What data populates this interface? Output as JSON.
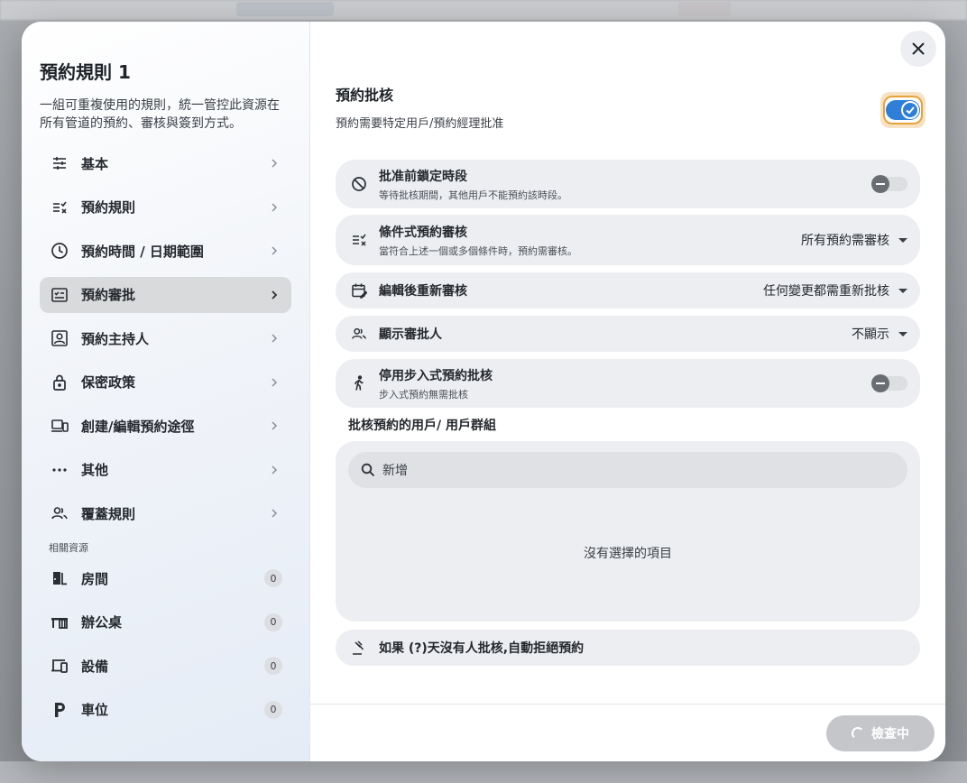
{
  "modal": {
    "title": "預約規則 1",
    "description": "一組可重複使用的規則，統一管控此資源在所有管道的預約、審核與簽到方式。"
  },
  "sidebar": {
    "items": [
      {
        "label": "基本",
        "icon": "sliders-icon"
      },
      {
        "label": "預約規則",
        "icon": "rules-list-icon"
      },
      {
        "label": "預約時間 / 日期範圍",
        "icon": "clock-icon"
      },
      {
        "label": "預約審批",
        "icon": "approval-checklist-icon",
        "active": true
      },
      {
        "label": "預約主持人",
        "icon": "host-badge-icon"
      },
      {
        "label": "保密政策",
        "icon": "lock-icon"
      },
      {
        "label": "創建/編輯預約途徑",
        "icon": "devices-icon"
      },
      {
        "label": "其他",
        "icon": "more-dots-icon"
      },
      {
        "label": "覆蓋規則",
        "icon": "people-icon"
      }
    ],
    "related_label": "相關資源",
    "resources": [
      {
        "label": "房間",
        "count": "0",
        "icon": "door-icon"
      },
      {
        "label": "辦公桌",
        "count": "0",
        "icon": "desk-icon"
      },
      {
        "label": "設備",
        "count": "0",
        "icon": "equipment-icon"
      },
      {
        "label": "車位",
        "count": "0",
        "icon": "parking-icon"
      }
    ]
  },
  "main": {
    "title": "預約批核",
    "subtitle": "預約需要特定用戶/預約經理批准",
    "approval_enabled": true,
    "rows": {
      "lock": {
        "title": "批准前鎖定時段",
        "desc": "等待批核期間，其他用戶不能預約該時段。",
        "enabled": false
      },
      "conditional": {
        "title": "條件式預約審核",
        "desc": "當符合上述一個或多個條件時，預約需審核。",
        "value": "所有預約需審核"
      },
      "reapprove": {
        "title": "編輯後重新審核",
        "value": "任何變更都需重新批核"
      },
      "show_approver": {
        "title": "顯示審批人",
        "value": "不顯示"
      },
      "walkin": {
        "title": "停用步入式預約批核",
        "desc": "步入式預約無需批核",
        "enabled": false
      },
      "auto_reject": {
        "title": "如果 (?)天沒有人批核,自動拒絕預約"
      }
    },
    "approvers_label": "批核預約的用戶/ 用戶群組",
    "search_placeholder": "新增",
    "empty_text": "沒有選擇的項目"
  },
  "footer": {
    "check_label": "檢查中"
  },
  "colors": {
    "accent": "#2f7ed8",
    "focus_ring": "#e6a33a",
    "active_nav": "#d9dadc",
    "row_bg": "#eceef1"
  }
}
